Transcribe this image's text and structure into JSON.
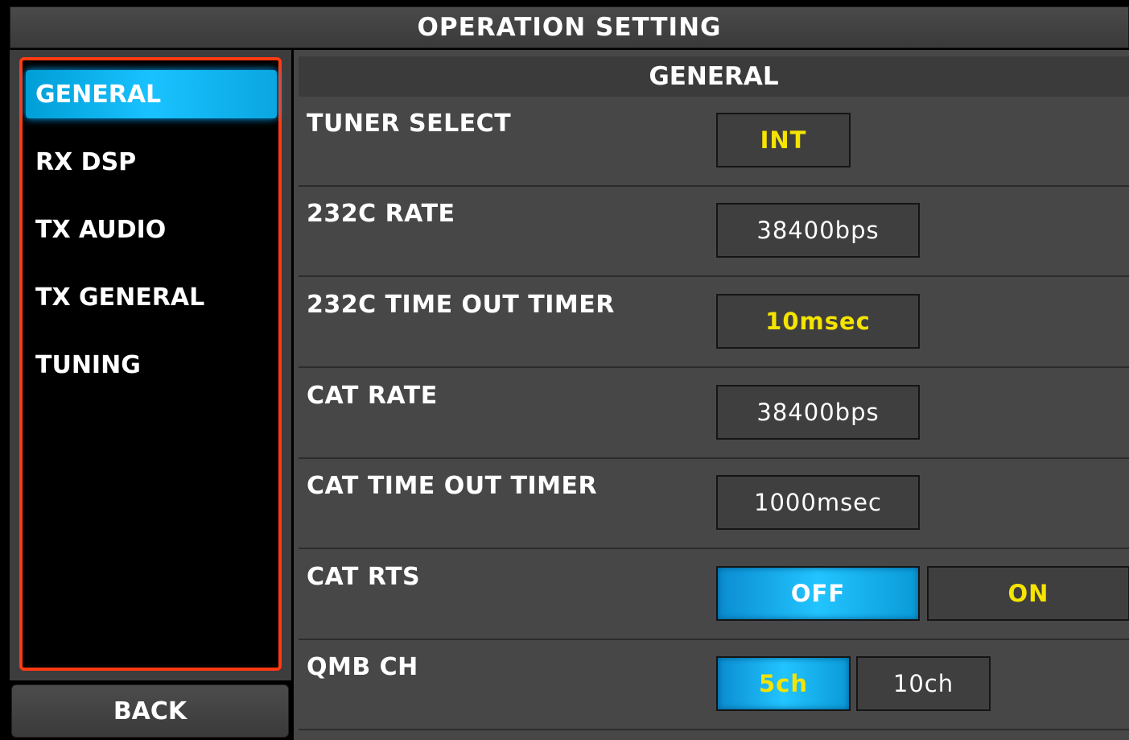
{
  "window": {
    "title": "OPERATION SETTING"
  },
  "sidebar": {
    "items": [
      {
        "label": "GENERAL",
        "active": true
      },
      {
        "label": "RX DSP",
        "active": false
      },
      {
        "label": "TX AUDIO",
        "active": false
      },
      {
        "label": "TX GENERAL",
        "active": false
      },
      {
        "label": "TUNING",
        "active": false
      }
    ],
    "back_label": "BACK"
  },
  "main": {
    "section_title": "GENERAL",
    "rows": [
      {
        "label": "TUNER SELECT",
        "value": "INT"
      },
      {
        "label": "232C RATE",
        "value": "38400bps"
      },
      {
        "label": "232C TIME OUT TIMER",
        "value": "10msec"
      },
      {
        "label": "CAT RATE",
        "value": "38400bps"
      },
      {
        "label": "CAT TIME OUT TIMER",
        "value": "1000msec"
      },
      {
        "label": "CAT RTS",
        "options": [
          "OFF",
          "ON"
        ],
        "selected": "OFF"
      },
      {
        "label": "QMB CH",
        "options": [
          "5ch",
          "10ch"
        ],
        "selected": "5ch"
      }
    ]
  },
  "colors": {
    "accent_border": "#ff3a12",
    "selected_blue": "#19c2ff",
    "value_yellow": "#f5e400"
  }
}
